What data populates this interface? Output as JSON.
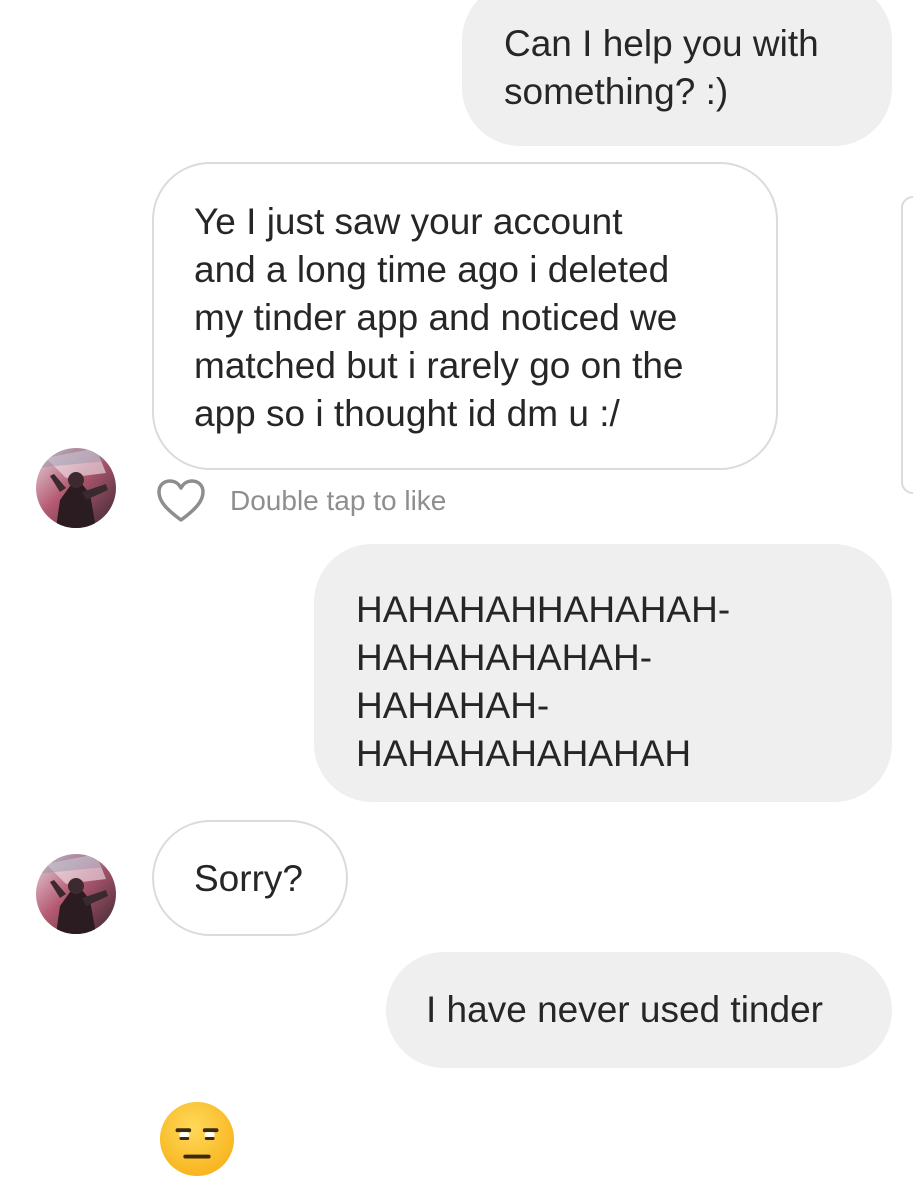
{
  "thread": {
    "messages": [
      {
        "from": "me",
        "text": "Can I help you with\nsomething? :)"
      },
      {
        "from": "them",
        "text": "Ye I just saw your account\nand a long time ago i deleted\nmy tinder app and noticed we\nmatched but i rarely go on the\napp so i thought id dm u :/"
      },
      {
        "from": "me",
        "text": "HAHAHAHHAHAHAH-\nHAHAHAHAHAH-\nHAHAHAH-\nHAHAHAHAHAHAH"
      },
      {
        "from": "them",
        "text": "Sorry?"
      },
      {
        "from": "me",
        "text": "I have never used tinder"
      }
    ],
    "like_hint": "Double tap to like",
    "reply_emoji": "expressionless-unamused-emoji"
  },
  "icons": {
    "like": "heart-outline-icon",
    "avatar": "contact-avatar"
  },
  "colors": {
    "sent_bubble": "#efefef",
    "received_border": "#dbdbdb",
    "text": "#262626",
    "hint_text": "#8e8e8e",
    "emoji_face": "#fcc21b"
  }
}
